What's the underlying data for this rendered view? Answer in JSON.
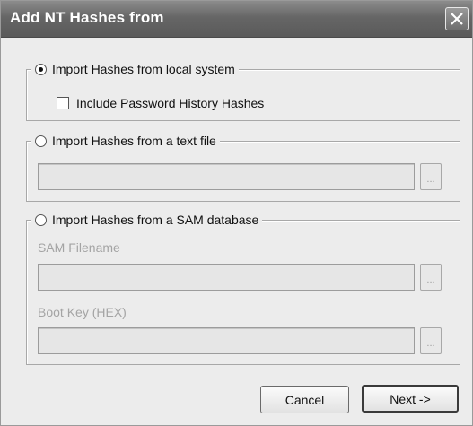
{
  "window": {
    "title": "Add NT Hashes from"
  },
  "local": {
    "radio_label": "Import Hashes from local system",
    "selected": true,
    "history_checkbox_label": "Include Password History Hashes",
    "history_checked": false
  },
  "text_file": {
    "radio_label": "Import Hashes from a text file",
    "selected": false,
    "path_value": "",
    "browse_label": "..."
  },
  "sam": {
    "radio_label": "Import Hashes from a SAM database",
    "selected": false,
    "filename_label": "SAM Filename",
    "filename_value": "",
    "bootkey_label": "Boot Key (HEX)",
    "bootkey_value": "",
    "browse_label": "..."
  },
  "buttons": {
    "cancel": "Cancel",
    "next": "Next ->"
  }
}
